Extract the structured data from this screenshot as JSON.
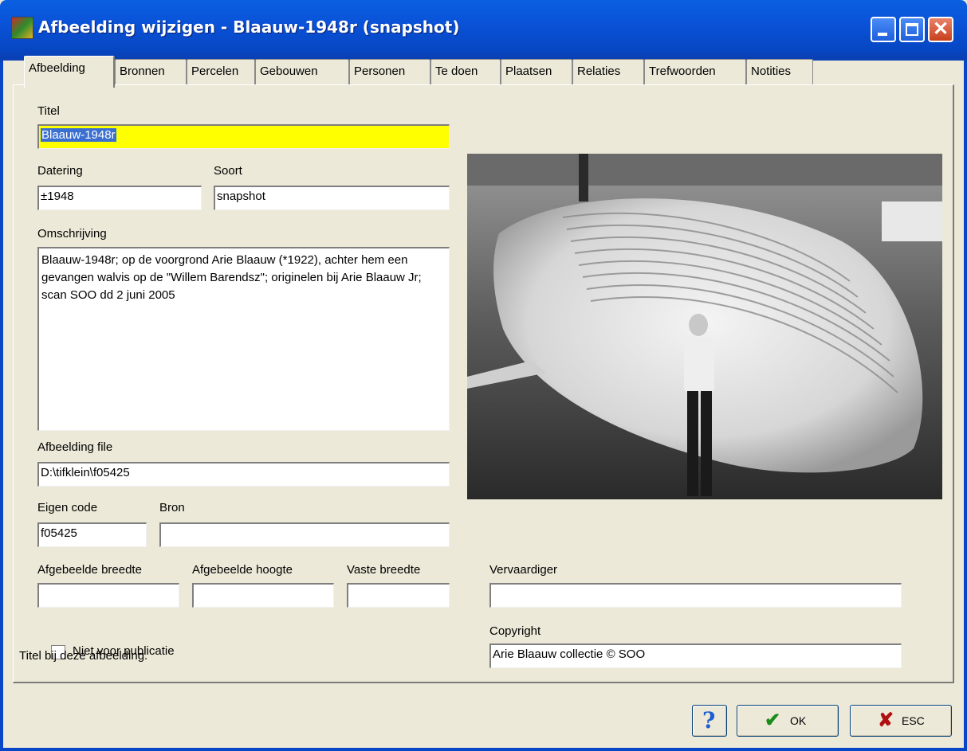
{
  "window": {
    "title": "Afbeelding wijzigen - Blaauw-1948r (snapshot)",
    "icons": [
      "app-icon",
      "minimize-icon",
      "maximize-icon",
      "close-icon"
    ]
  },
  "tabs": [
    {
      "label": "Afbeelding",
      "active": true
    },
    {
      "label": "Bronnen"
    },
    {
      "label": "Percelen"
    },
    {
      "label": "Gebouwen"
    },
    {
      "label": "Personen"
    },
    {
      "label": "Te doen"
    },
    {
      "label": "Plaatsen"
    },
    {
      "label": "Relaties"
    },
    {
      "label": "Trefwoorden"
    },
    {
      "label": "Notities"
    }
  ],
  "form": {
    "titel_label": "Titel",
    "titel_value": "Blaauw-1948r",
    "datering_label": "Datering",
    "datering_value": "±1948",
    "soort_label": "Soort",
    "soort_value": "snapshot",
    "omschrijving_label": "Omschrijving",
    "omschrijving_value": "Blaauw-1948r; op de voorgrond Arie Blaauw (*1922), achter hem een gevangen walvis op de \"Willem Barendsz\"; originelen bij Arie Blaauw Jr; scan SOO dd 2 juni 2005",
    "file_label": "Afbeelding file",
    "file_value": "D:\\tifklein\\f05425",
    "eigen_code_label": "Eigen code",
    "eigen_code_value": "f05425",
    "bron_label": "Bron",
    "bron_value": "",
    "breedte_label": "Afgebeelde breedte",
    "breedte_value": "",
    "hoogte_label": "Afgebeelde hoogte",
    "hoogte_value": "",
    "vaste_breedte_label": "Vaste breedte",
    "vaste_breedte_value": "",
    "vervaardiger_label": "Vervaardiger",
    "vervaardiger_value": "",
    "copyright_label": "Copyright",
    "copyright_value": "Arie Blaauw collectie © SOO",
    "niet_voor_publicatie_label": "Niet voor publicatie",
    "niet_voor_publicatie_checked": false
  },
  "status": {
    "hint": "Titel bij deze afbeelding."
  },
  "buttons": {
    "help_glyph": "?",
    "ok_label": "OK",
    "esc_label": "ESC"
  },
  "colors": {
    "titlebar": "#0a52d8",
    "highlight_field": "#ffff00",
    "dialog_bg": "#ece9d8",
    "ok_check": "#1a8c1a",
    "esc_x": "#b01010",
    "help": "#1e5fd0"
  }
}
